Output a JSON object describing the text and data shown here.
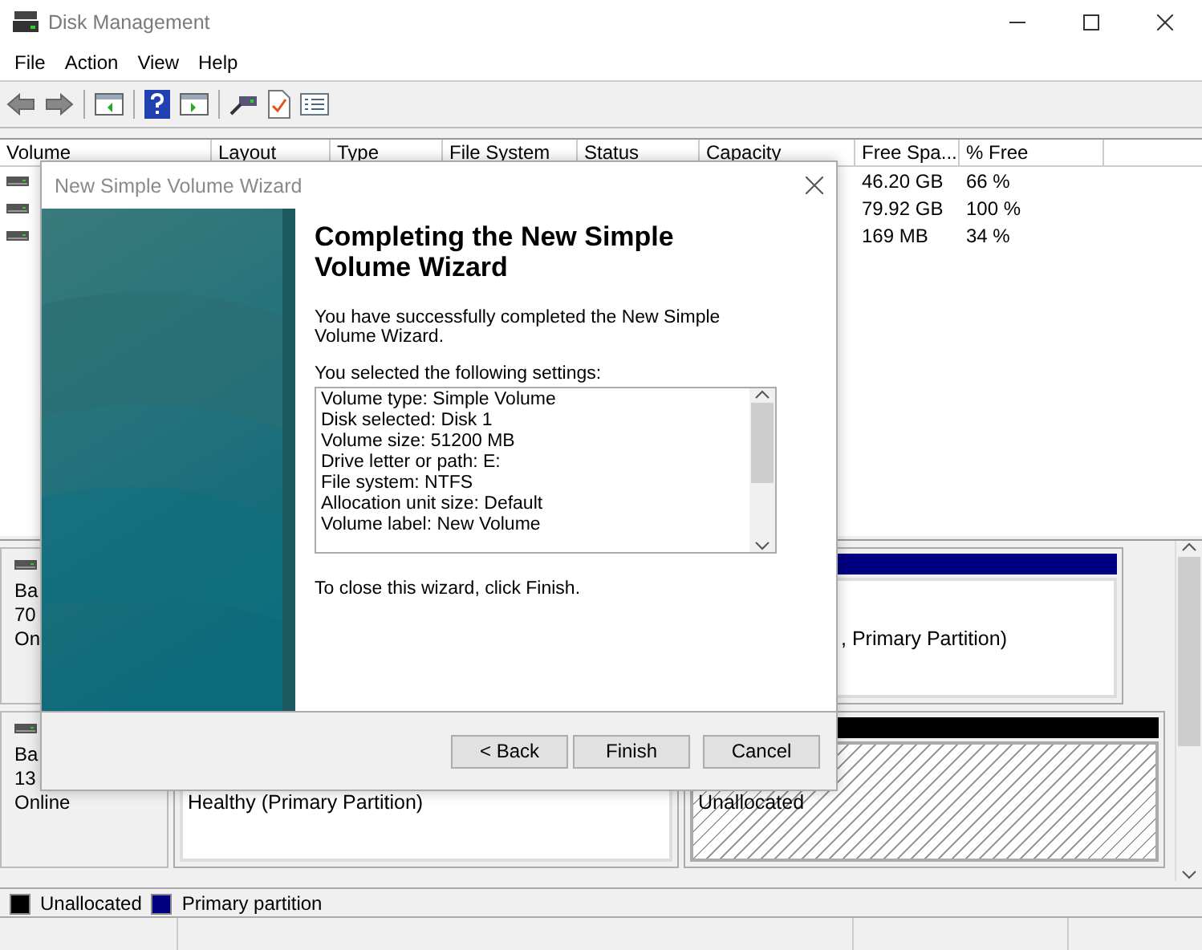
{
  "window": {
    "title": "Disk Management"
  },
  "menu": [
    "File",
    "Action",
    "View",
    "Help"
  ],
  "volume_table": {
    "columns": [
      "Volume",
      "Layout",
      "Type",
      "File System",
      "Status",
      "Capacity",
      "Free Spa...",
      "% Free"
    ],
    "rows": [
      {
        "free_space": "46.20 GB",
        "percent_free": "66 %"
      },
      {
        "free_space": "79.92 GB",
        "percent_free": "100 %"
      },
      {
        "free_space": "169 MB",
        "percent_free": "34 %"
      }
    ]
  },
  "disks": [
    {
      "info": [
        "Ba",
        "70",
        "On"
      ],
      "partitions": [
        {
          "kind": "primary",
          "text": ", Primary Partition)"
        }
      ]
    },
    {
      "info": [
        "Ba",
        "13",
        "Online"
      ],
      "partitions": [
        {
          "kind": "primary",
          "text": "Healthy (Primary Partition)"
        },
        {
          "kind": "unallocated",
          "text": "Unallocated"
        }
      ]
    }
  ],
  "legend": [
    {
      "label": "Unallocated",
      "color": "#000000"
    },
    {
      "label": "Primary partition",
      "color": "#000080"
    }
  ],
  "dialog": {
    "title": "New Simple Volume Wizard",
    "heading": "Completing the New Simple Volume Wizard",
    "intro": "You have successfully completed the New Simple Volume Wizard.",
    "settings_label": "You selected the following settings:",
    "settings": [
      "Volume type: Simple Volume",
      "Disk selected: Disk 1",
      "Volume size: 51200 MB",
      "Drive letter or path: E:",
      "File system: NTFS",
      "Allocation unit size: Default",
      "Volume label: New Volume"
    ],
    "closing": "To close this wizard, click Finish.",
    "buttons": [
      {
        "label": "< Back"
      },
      {
        "label": "Finish"
      },
      {
        "label": "Cancel"
      }
    ]
  }
}
